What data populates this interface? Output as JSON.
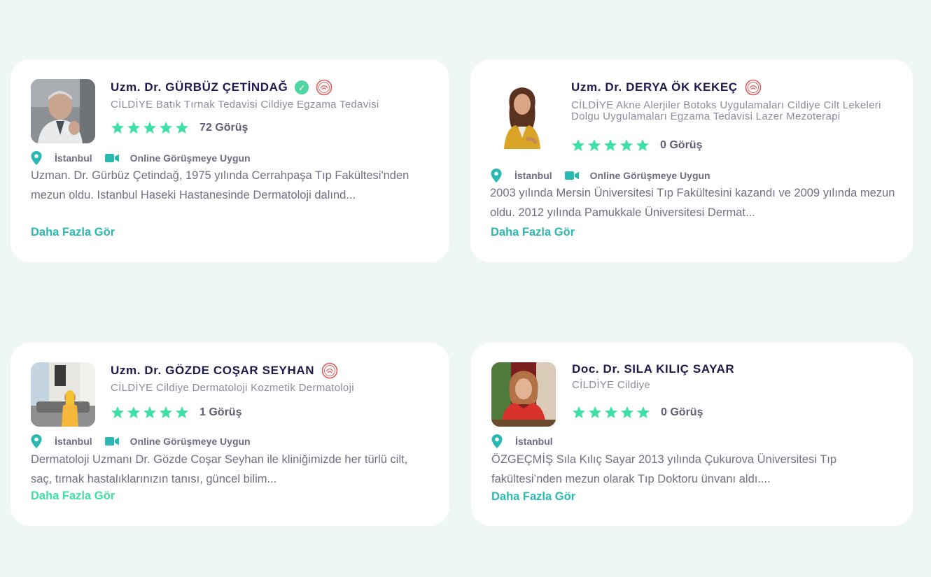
{
  "colors": {
    "background": "#eef7f3",
    "card": "#ffffff",
    "name": "#1c1a4d",
    "star": "#3ee0a6",
    "accent_teal": "#2bb8b0",
    "accent_green": "#3ee09f",
    "verified": "#4fd4a3",
    "ministry_seal": "#e05a5a"
  },
  "doctors": [
    {
      "name": "Uzm. Dr. GÜRBÜZ ÇETİNDAĞ",
      "specialties": "CİLDİYE Batık Tırnak Tedavisi Cildiye Egzama Tedavisi",
      "rating_stars": 5,
      "reviews": "72 Görüş",
      "city": "İstanbul",
      "online": "Online Görüşmeye Uygun",
      "bio": "Uzman. Dr. Gürbüz Çetindağ, 1975 yılında Cerrahpaşa Tıp Fakültesi'nden mezun oldu. Istanbul Haseki Hastanesinde Dermatoloji dalınd...",
      "more": "Daha Fazla Gör",
      "icons": [
        "verified-check-icon",
        "ministry-seal-icon"
      ]
    },
    {
      "name": "Uzm. Dr. DERYA ÖK KEKEÇ",
      "specialties": "CİLDİYE Akne Alerjiler Botoks Uygulamaları Cildiye Cilt Lekeleri Dolgu Uygulamaları Egzama Tedavisi Lazer Mezoterapi",
      "rating_stars": 5,
      "reviews": "0 Görüş",
      "city": "İstanbul",
      "online": "Online Görüşmeye Uygun",
      "bio": " 2003 yılında Mersin Üniversitesi Tıp Fakültesini kazandı ve 2009 yılında mezun oldu. 2012 yılında Pamukkale Üniversitesi Dermat...",
      "more": "Daha Fazla Gör",
      "icons": [
        "ministry-seal-icon"
      ]
    },
    {
      "name": "Uzm. Dr. GÖZDE COŞAR SEYHAN",
      "specialties": "CİLDİYE Cildiye Dermatoloji Kozmetik Dermatoloji",
      "rating_stars": 5,
      "reviews": "1 Görüş",
      "city": "İstanbul",
      "online": "Online Görüşmeye Uygun",
      "bio": "Dermatoloji Uzmanı Dr. Gözde Coşar Seyhan ile kliniğimizde her türlü cilt, saç, tırnak hastalıklarınızın tanısı, güncel bilim...",
      "more": "Daha Fazla Gör",
      "icons": [
        "ministry-seal-icon"
      ]
    },
    {
      "name": "Doc. Dr. SILA KILIÇ SAYAR",
      "specialties": "CİLDİYE Cildiye",
      "rating_stars": 5,
      "reviews": "0 Görüş",
      "city": "İstanbul",
      "bio": "ÖZGEÇMİŞ Sıla Kılıç Sayar 2013 yılında Çukurova Üniversitesi Tıp fakültesi’nden mezun olarak Tıp Doktoru ünvanı aldı....",
      "more": "Daha Fazla Gör",
      "icons": []
    }
  ]
}
